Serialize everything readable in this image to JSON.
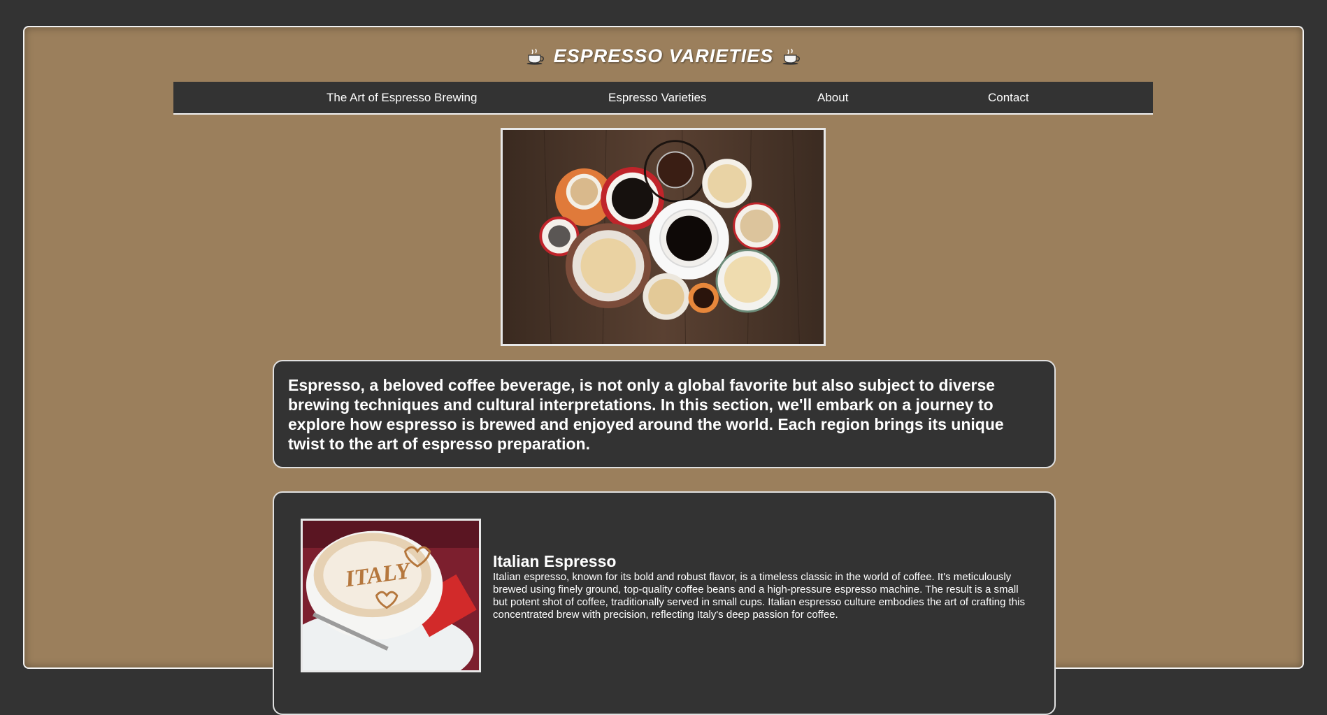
{
  "header": {
    "title": "ESPRESSO VARIETIES",
    "icon_left": "coffee-cup-icon",
    "icon_right": "coffee-cup-icon"
  },
  "nav": {
    "items": [
      {
        "label": "The Art of Espresso Brewing"
      },
      {
        "label": "Espresso Varieties"
      },
      {
        "label": "About"
      },
      {
        "label": "Contact"
      }
    ]
  },
  "hero": {
    "image": "assorted-coffee-cups-photo"
  },
  "intro": {
    "text": "Espresso, a beloved coffee beverage, is not only a global favorite but also subject to diverse brewing techniques and cultural interpretations. In this section, we'll embark on a journey to explore how espresso is brewed and enjoyed around the world. Each region brings its unique twist to the art of espresso preparation."
  },
  "varieties": [
    {
      "image": "italy-latte-art-photo",
      "image_text": "ITALY",
      "title": "Italian Espresso",
      "description": "Italian espresso, known for its bold and robust flavor, is a timeless classic in the world of coffee. It's meticulously brewed using finely ground, top-quality coffee beans and a high-pressure espresso machine. The result is a small but potent shot of coffee, traditionally served in small cups. Italian espresso culture embodies the art of crafting this concentrated brew with precision, reflecting Italy's deep passion for coffee."
    }
  ],
  "colors": {
    "page_background": "#333333",
    "frame_background": "#9b7f5c",
    "panel_background": "#333333",
    "border": "#f2f2f2",
    "text": "#ffffff"
  }
}
